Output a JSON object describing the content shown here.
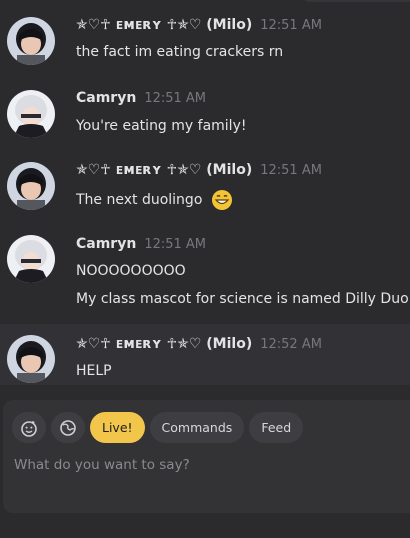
{
  "messages": [
    {
      "author": "✯♡☥ ᴇᴍᴇʀʏ ☥✯♡ (Milo)",
      "time": "12:51 AM",
      "lines": [
        "the fact im eating crackers rn"
      ]
    },
    {
      "author": "Camryn",
      "time": "12:51 AM",
      "lines": [
        "You're eating my family!"
      ]
    },
    {
      "author": "✯♡☥ ᴇᴍᴇʀʏ ☥✯♡ (Milo)",
      "time": "12:51 AM",
      "lines": [
        "The next duolingo"
      ]
    },
    {
      "author": "Camryn",
      "time": "12:51 AM",
      "lines": [
        "NOOOOOOOOO",
        "My class mascot for science is named Dilly Duo"
      ]
    },
    {
      "author": "✯♡☥ ᴇᴍᴇʀʏ ☥✯♡ (Milo)",
      "time": "12:52 AM",
      "lines": [
        "HELP"
      ]
    }
  ],
  "composer": {
    "live_label": "Live!",
    "commands_label": "Commands",
    "feed_label": "Feed",
    "placeholder": "What do you want to say?",
    "icons": [
      "emoji-picker-icon",
      "globe-icon"
    ],
    "accent_color": "#f2c64a"
  }
}
